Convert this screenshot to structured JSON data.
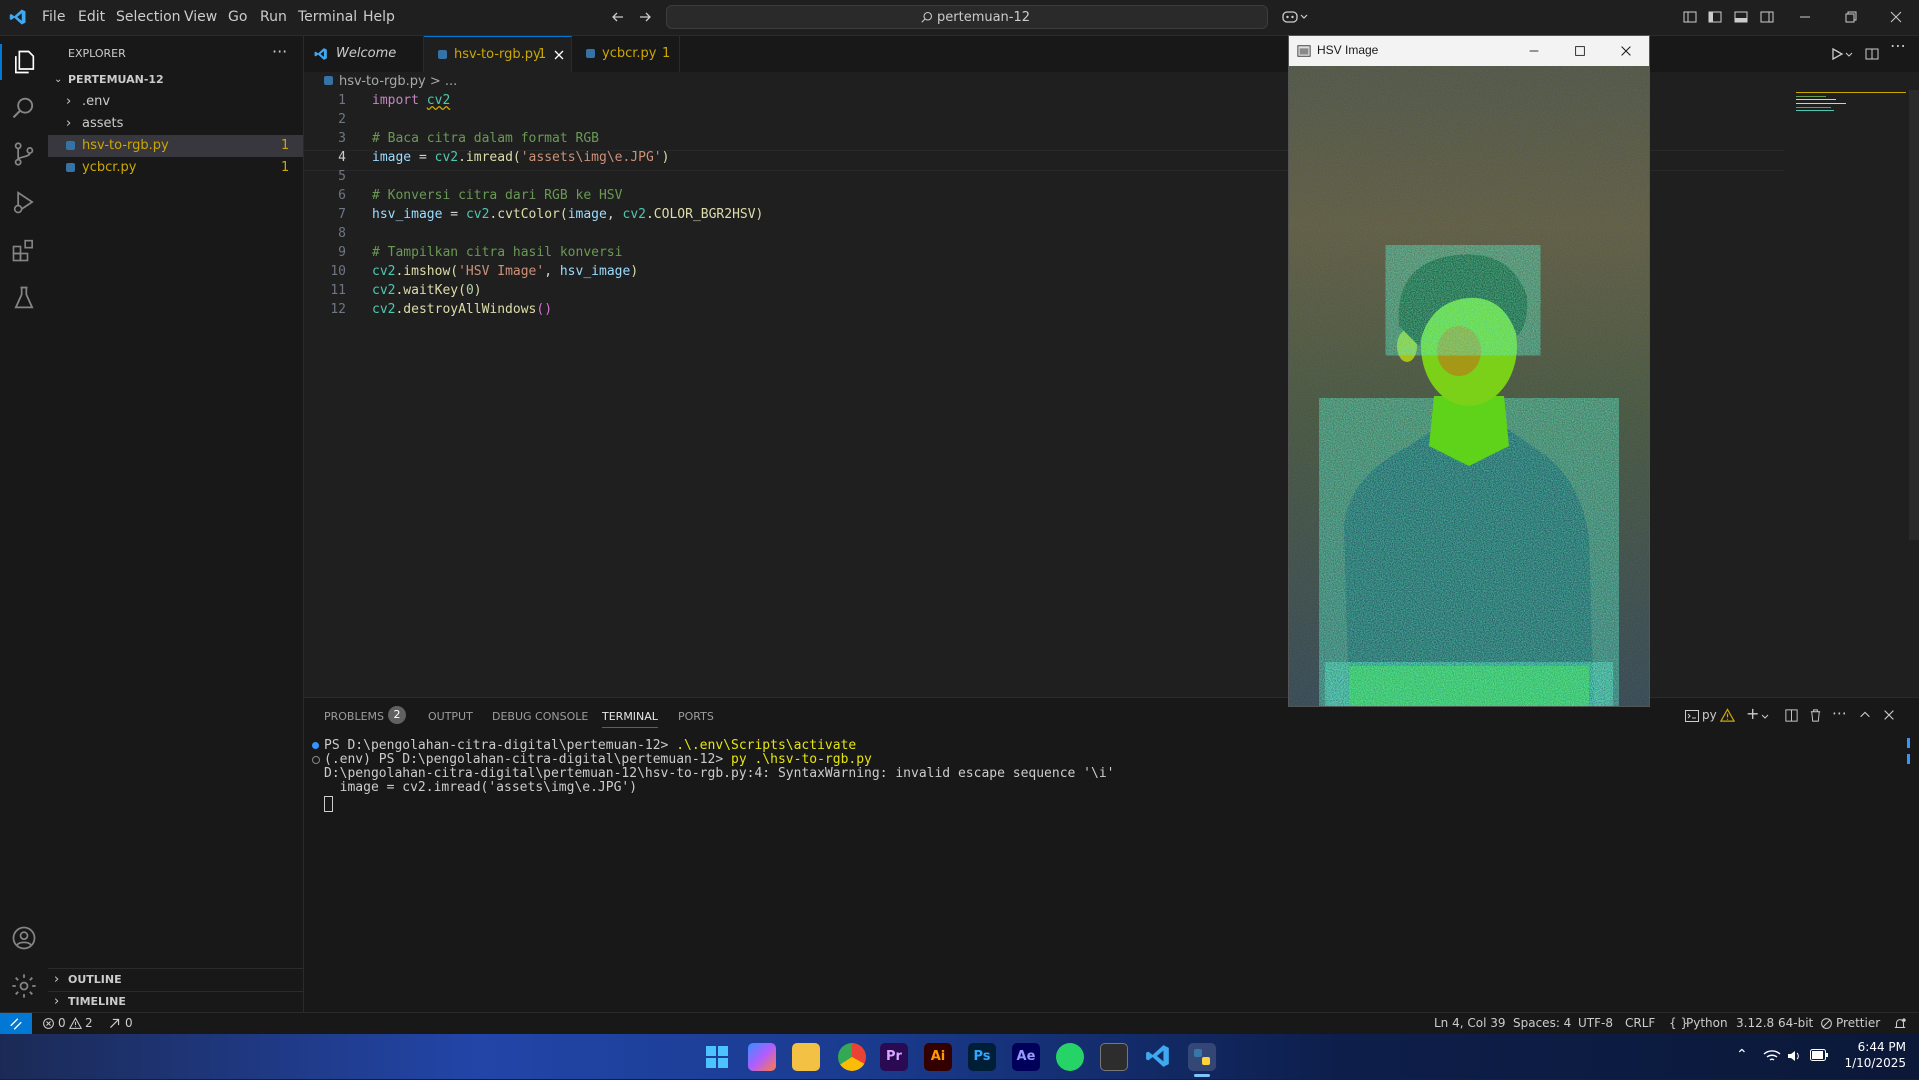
{
  "app": {
    "menu": [
      "File",
      "Edit",
      "Selection",
      "View",
      "Go",
      "Run",
      "Terminal",
      "Help"
    ],
    "search": "pertemuan-12"
  },
  "sidebar": {
    "title": "EXPLORER",
    "more": "···",
    "folder": "PERTEMUAN-12",
    "items": [
      {
        "label": ".env"
      },
      {
        "label": "assets"
      },
      {
        "label": "hsv-to-rgb.py",
        "badge": "1"
      },
      {
        "label": "ycbcr.py",
        "badge": "1"
      }
    ],
    "outline": "OUTLINE",
    "timeline": "TIMELINE"
  },
  "tabs": [
    {
      "label": "Welcome"
    },
    {
      "label": "hsv-to-rgb.py",
      "badge": "1"
    },
    {
      "label": "ycbcr.py",
      "badge": "1"
    }
  ],
  "breadcrumb": {
    "file": "hsv-to-rgb.py",
    "sep": ">",
    "rest": "..."
  },
  "code": {
    "l1a": "import ",
    "l1b": "cv2",
    "l3": "# Baca citra dalam format RGB",
    "l4a": "image",
    "l4b": " = ",
    "l4c": "cv2",
    "l4d": ".imread(",
    "l4e": "'assets\\img\\e.JPG'",
    "l4f": ")",
    "l6": "# Konversi citra dari RGB ke HSV",
    "l7a": "hsv_image",
    "l7b": " = ",
    "l7c": "cv2",
    "l7d": ".cvtColor(",
    "l7e": "image",
    "l7f": ", ",
    "l7g": "cv2",
    "l7h": ".COLOR_BGR2HSV)",
    "l9": "# Tampilkan citra hasil konversi",
    "l10a": "cv2",
    "l10b": ".imshow(",
    "l10c": "'HSV Image'",
    "l10d": ", ",
    "l10e": "hsv_image",
    "l10f": ")",
    "l11a": "cv2",
    "l11b": ".waitKey(",
    "l11c": "0",
    "l11d": ")",
    "l12a": "cv2",
    "l12b": ".destroyAllWindows",
    "l12c": "()"
  },
  "panel": {
    "tabs": [
      "PROBLEMS",
      "OUTPUT",
      "DEBUG CONSOLE",
      "TERMINAL",
      "PORTS"
    ],
    "problems_count": "2",
    "terminal_label": "py",
    "lines": [
      {
        "prompt": "PS D:\\pengolahan-citra-digital\\pertemuan-12> ",
        "cmd": ".\\.env\\Scripts\\activate"
      },
      {
        "prompt": "(.env) PS D:\\pengolahan-citra-digital\\pertemuan-12> ",
        "cmd": "py .\\hsv-to-rgb.py"
      },
      {
        "text": "D:\\pengolahan-citra-digital\\pertemuan-12\\hsv-to-rgb.py:4: SyntaxWarning: invalid escape sequence '\\i'"
      },
      {
        "text": "  image = cv2.imread('assets\\img\\e.JPG')"
      }
    ]
  },
  "status": {
    "errors": "0",
    "warnings": "2",
    "ports": "0",
    "position": "Ln 4, Col 39",
    "spaces": "Spaces: 4",
    "encoding": "UTF-8",
    "eol": "CRLF",
    "lang": "Python",
    "version": "3.12.8 64-bit",
    "prettier": "Prettier"
  },
  "hsv_window": {
    "title": "HSV Image"
  },
  "taskbar": {
    "apps": [
      "Pr",
      "Ai",
      "Ps",
      "Ae"
    ],
    "time": "6:44 PM",
    "date": "1/10/2025"
  },
  "colors": {
    "accent": "#0078d4",
    "keyword": "#c586c0",
    "comment": "#6a9955",
    "string": "#ce9178",
    "variable": "#9cdcfe",
    "class": "#4ec9b0",
    "function": "#dcdcaa",
    "number": "#b5cea8",
    "warning": "#cca700"
  }
}
